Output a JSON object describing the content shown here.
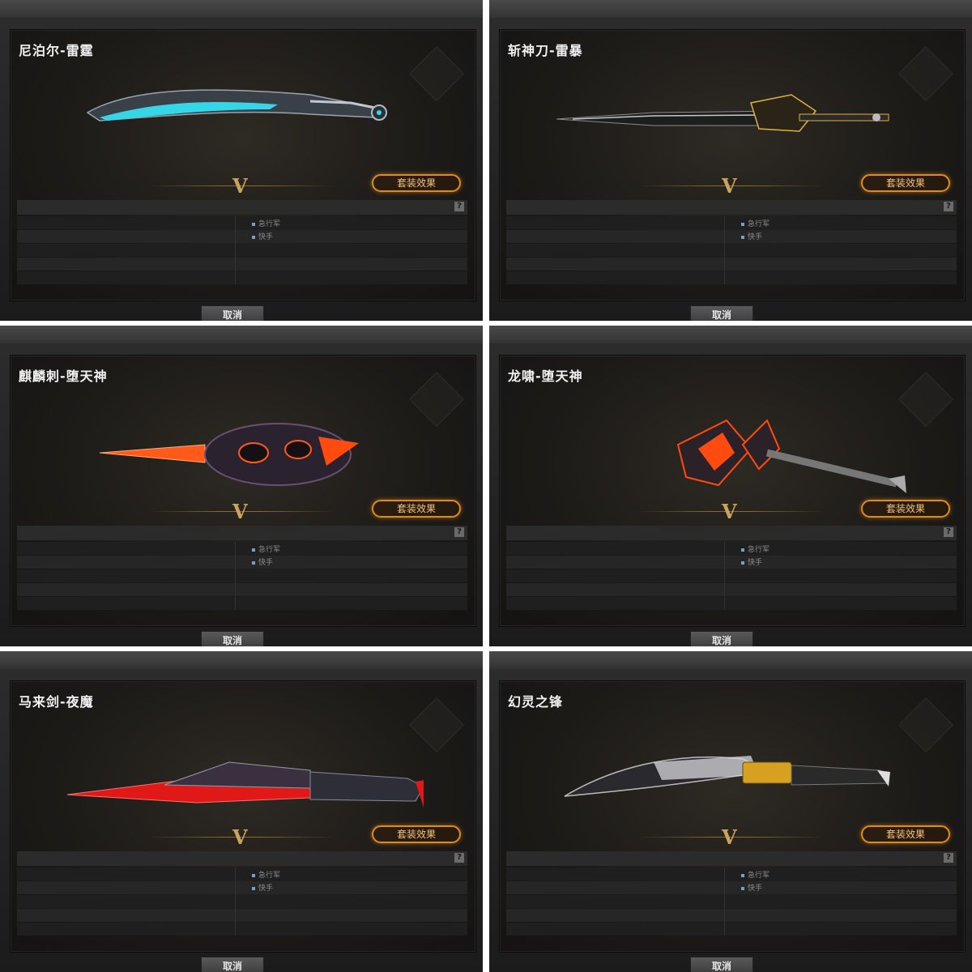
{
  "panels": [
    {
      "title": "尼泊尔-雷霆",
      "set_button": "套装效果",
      "help": "?",
      "tags": [
        "急行军",
        "快手"
      ],
      "cancel": "取消",
      "accent": "#35d6e8"
    },
    {
      "title": "斩神刀-雷暴",
      "set_button": "套装效果",
      "help": "?",
      "tags": [
        "急行军",
        "快手"
      ],
      "cancel": "取消",
      "accent": "#e0b23a"
    },
    {
      "title": "麒麟刺-堕天神",
      "set_button": "套装效果",
      "help": "?",
      "tags": [
        "急行军",
        "快手"
      ],
      "cancel": "取消",
      "accent": "#ff5a1a"
    },
    {
      "title": "龙啸-堕天神",
      "set_button": "套装效果",
      "help": "?",
      "tags": [
        "急行军",
        "快手"
      ],
      "cancel": "取消",
      "accent": "#ff4a10"
    },
    {
      "title": "马来剑-夜魔",
      "set_button": "套装效果",
      "help": "?",
      "tags": [
        "急行军",
        "快手"
      ],
      "cancel": "取消",
      "accent": "#e01818"
    },
    {
      "title": "幻灵之锋",
      "set_button": "套装效果",
      "help": "?",
      "tags": [
        "急行军",
        "快手"
      ],
      "cancel": "取消",
      "accent": "#d8a020"
    }
  ],
  "rank_mark": "V"
}
